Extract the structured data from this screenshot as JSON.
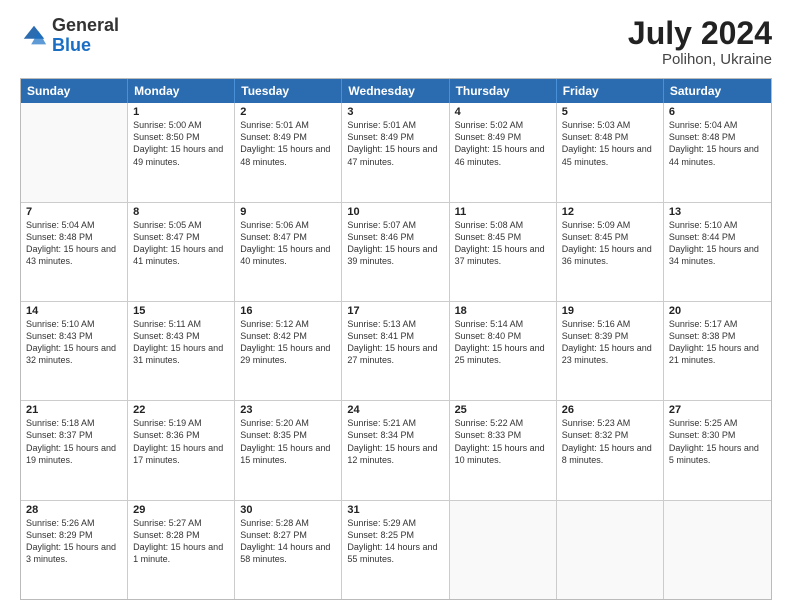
{
  "header": {
    "logo": {
      "general": "General",
      "blue": "Blue"
    },
    "title": "July 2024",
    "location": "Polihon, Ukraine"
  },
  "days_of_week": [
    "Sunday",
    "Monday",
    "Tuesday",
    "Wednesday",
    "Thursday",
    "Friday",
    "Saturday"
  ],
  "weeks": [
    [
      {
        "day": "",
        "empty": true
      },
      {
        "day": "1",
        "sunrise": "Sunrise: 5:00 AM",
        "sunset": "Sunset: 8:50 PM",
        "daylight": "Daylight: 15 hours and 49 minutes."
      },
      {
        "day": "2",
        "sunrise": "Sunrise: 5:01 AM",
        "sunset": "Sunset: 8:49 PM",
        "daylight": "Daylight: 15 hours and 48 minutes."
      },
      {
        "day": "3",
        "sunrise": "Sunrise: 5:01 AM",
        "sunset": "Sunset: 8:49 PM",
        "daylight": "Daylight: 15 hours and 47 minutes."
      },
      {
        "day": "4",
        "sunrise": "Sunrise: 5:02 AM",
        "sunset": "Sunset: 8:49 PM",
        "daylight": "Daylight: 15 hours and 46 minutes."
      },
      {
        "day": "5",
        "sunrise": "Sunrise: 5:03 AM",
        "sunset": "Sunset: 8:48 PM",
        "daylight": "Daylight: 15 hours and 45 minutes."
      },
      {
        "day": "6",
        "sunrise": "Sunrise: 5:04 AM",
        "sunset": "Sunset: 8:48 PM",
        "daylight": "Daylight: 15 hours and 44 minutes."
      }
    ],
    [
      {
        "day": "7",
        "sunrise": "Sunrise: 5:04 AM",
        "sunset": "Sunset: 8:48 PM",
        "daylight": "Daylight: 15 hours and 43 minutes."
      },
      {
        "day": "8",
        "sunrise": "Sunrise: 5:05 AM",
        "sunset": "Sunset: 8:47 PM",
        "daylight": "Daylight: 15 hours and 41 minutes."
      },
      {
        "day": "9",
        "sunrise": "Sunrise: 5:06 AM",
        "sunset": "Sunset: 8:47 PM",
        "daylight": "Daylight: 15 hours and 40 minutes."
      },
      {
        "day": "10",
        "sunrise": "Sunrise: 5:07 AM",
        "sunset": "Sunset: 8:46 PM",
        "daylight": "Daylight: 15 hours and 39 minutes."
      },
      {
        "day": "11",
        "sunrise": "Sunrise: 5:08 AM",
        "sunset": "Sunset: 8:45 PM",
        "daylight": "Daylight: 15 hours and 37 minutes."
      },
      {
        "day": "12",
        "sunrise": "Sunrise: 5:09 AM",
        "sunset": "Sunset: 8:45 PM",
        "daylight": "Daylight: 15 hours and 36 minutes."
      },
      {
        "day": "13",
        "sunrise": "Sunrise: 5:10 AM",
        "sunset": "Sunset: 8:44 PM",
        "daylight": "Daylight: 15 hours and 34 minutes."
      }
    ],
    [
      {
        "day": "14",
        "sunrise": "Sunrise: 5:10 AM",
        "sunset": "Sunset: 8:43 PM",
        "daylight": "Daylight: 15 hours and 32 minutes."
      },
      {
        "day": "15",
        "sunrise": "Sunrise: 5:11 AM",
        "sunset": "Sunset: 8:43 PM",
        "daylight": "Daylight: 15 hours and 31 minutes."
      },
      {
        "day": "16",
        "sunrise": "Sunrise: 5:12 AM",
        "sunset": "Sunset: 8:42 PM",
        "daylight": "Daylight: 15 hours and 29 minutes."
      },
      {
        "day": "17",
        "sunrise": "Sunrise: 5:13 AM",
        "sunset": "Sunset: 8:41 PM",
        "daylight": "Daylight: 15 hours and 27 minutes."
      },
      {
        "day": "18",
        "sunrise": "Sunrise: 5:14 AM",
        "sunset": "Sunset: 8:40 PM",
        "daylight": "Daylight: 15 hours and 25 minutes."
      },
      {
        "day": "19",
        "sunrise": "Sunrise: 5:16 AM",
        "sunset": "Sunset: 8:39 PM",
        "daylight": "Daylight: 15 hours and 23 minutes."
      },
      {
        "day": "20",
        "sunrise": "Sunrise: 5:17 AM",
        "sunset": "Sunset: 8:38 PM",
        "daylight": "Daylight: 15 hours and 21 minutes."
      }
    ],
    [
      {
        "day": "21",
        "sunrise": "Sunrise: 5:18 AM",
        "sunset": "Sunset: 8:37 PM",
        "daylight": "Daylight: 15 hours and 19 minutes."
      },
      {
        "day": "22",
        "sunrise": "Sunrise: 5:19 AM",
        "sunset": "Sunset: 8:36 PM",
        "daylight": "Daylight: 15 hours and 17 minutes."
      },
      {
        "day": "23",
        "sunrise": "Sunrise: 5:20 AM",
        "sunset": "Sunset: 8:35 PM",
        "daylight": "Daylight: 15 hours and 15 minutes."
      },
      {
        "day": "24",
        "sunrise": "Sunrise: 5:21 AM",
        "sunset": "Sunset: 8:34 PM",
        "daylight": "Daylight: 15 hours and 12 minutes."
      },
      {
        "day": "25",
        "sunrise": "Sunrise: 5:22 AM",
        "sunset": "Sunset: 8:33 PM",
        "daylight": "Daylight: 15 hours and 10 minutes."
      },
      {
        "day": "26",
        "sunrise": "Sunrise: 5:23 AM",
        "sunset": "Sunset: 8:32 PM",
        "daylight": "Daylight: 15 hours and 8 minutes."
      },
      {
        "day": "27",
        "sunrise": "Sunrise: 5:25 AM",
        "sunset": "Sunset: 8:30 PM",
        "daylight": "Daylight: 15 hours and 5 minutes."
      }
    ],
    [
      {
        "day": "28",
        "sunrise": "Sunrise: 5:26 AM",
        "sunset": "Sunset: 8:29 PM",
        "daylight": "Daylight: 15 hours and 3 minutes."
      },
      {
        "day": "29",
        "sunrise": "Sunrise: 5:27 AM",
        "sunset": "Sunset: 8:28 PM",
        "daylight": "Daylight: 15 hours and 1 minute."
      },
      {
        "day": "30",
        "sunrise": "Sunrise: 5:28 AM",
        "sunset": "Sunset: 8:27 PM",
        "daylight": "Daylight: 14 hours and 58 minutes."
      },
      {
        "day": "31",
        "sunrise": "Sunrise: 5:29 AM",
        "sunset": "Sunset: 8:25 PM",
        "daylight": "Daylight: 14 hours and 55 minutes."
      },
      {
        "day": "",
        "empty": true
      },
      {
        "day": "",
        "empty": true
      },
      {
        "day": "",
        "empty": true
      }
    ]
  ]
}
